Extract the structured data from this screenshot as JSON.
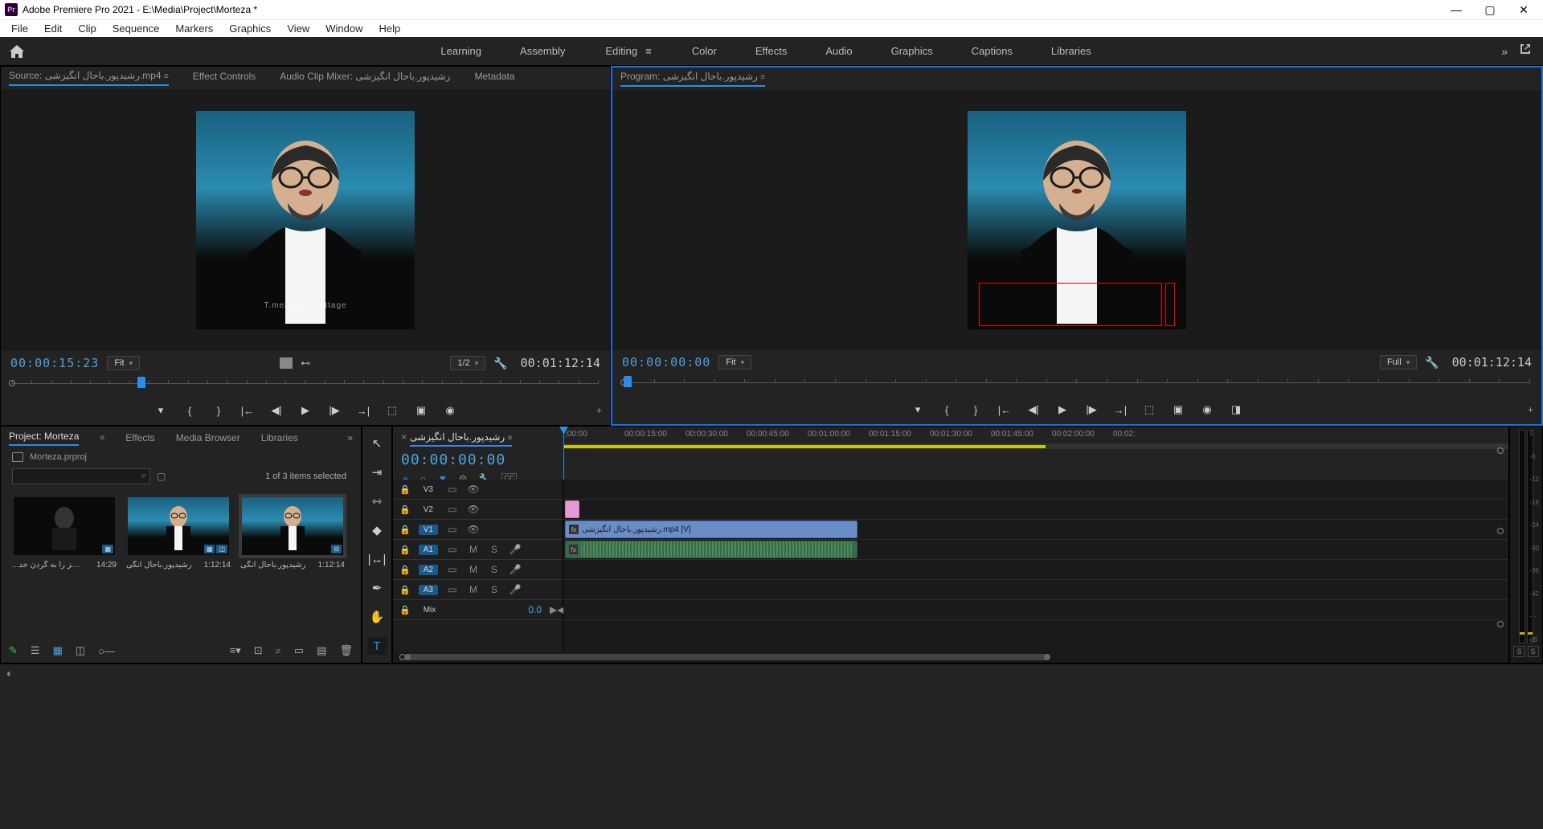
{
  "titlebar": {
    "app_icon_text": "Pr",
    "title": "Adobe Premiere Pro 2021 - E:\\Media\\Project\\Morteza *"
  },
  "menubar": [
    "File",
    "Edit",
    "Clip",
    "Sequence",
    "Markers",
    "Graphics",
    "View",
    "Window",
    "Help"
  ],
  "workspaces": {
    "items": [
      "Learning",
      "Assembly",
      "Editing",
      "Color",
      "Effects",
      "Audio",
      "Graphics",
      "Captions",
      "Libraries"
    ],
    "active": "Editing"
  },
  "source_panel": {
    "tabs": [
      "Source: رشیدپور.باحال انگیزشی.mp4",
      "Effect Controls",
      "Audio Clip Mixer: رشیدپور.باحال انگیزشی",
      "Metadata"
    ],
    "active_tab": 0,
    "watermark": "T.me/MovieCottage",
    "timecode": "00:00:15:23",
    "fit_label": "Fit",
    "ratio_label": "1/2",
    "duration": "00:01:12:14"
  },
  "program_panel": {
    "tab": "Program: رشیدپور.باحال انگیزشی",
    "timecode": "00:00:00:00",
    "fit_label": "Fit",
    "full_label": "Full",
    "duration": "00:01:12:14"
  },
  "project_panel": {
    "tabs": [
      "Project: Morteza",
      "Effects",
      "Media Browser",
      "Libraries"
    ],
    "active_tab": 0,
    "project_file": "Morteza.prproj",
    "search_placeholder": "",
    "selection_text": "1 of 3 items selected",
    "items": [
      {
        "name": "...همه چیز را به گردن خد",
        "duration": "14:29",
        "selected": false,
        "blue": false
      },
      {
        "name": "رشیدپور.باحال انگی",
        "duration": "1:12:14",
        "selected": false,
        "blue": true
      },
      {
        "name": "رشیدپور.باحال انگی",
        "duration": "1:12:14",
        "selected": true,
        "blue": true
      }
    ]
  },
  "timeline": {
    "sequence_name": "رشیدپور.باحال انگیزشی",
    "timecode": "00:00:00:00",
    "ruler_labels": [
      ";00:00",
      "00:00:15:00",
      "00:00:30:00",
      "00:00:45:00",
      "00:01:00:00",
      "00:01:15:00",
      "00:01:30:00",
      "00:01:45:00",
      "00:02:00:00",
      "00:02:"
    ],
    "video_tracks": [
      {
        "label": "V3",
        "active": false
      },
      {
        "label": "V2",
        "active": false
      },
      {
        "label": "V1",
        "active": true
      }
    ],
    "audio_tracks": [
      {
        "label": "A1",
        "active": true
      },
      {
        "label": "A2",
        "active": true
      },
      {
        "label": "A3",
        "active": true
      }
    ],
    "mix_label": "Mix",
    "mix_value": "0.0",
    "v1_clip_name": "رشیدپور.باحال انگیزشی.mp4 [V]"
  },
  "meters": {
    "scale": [
      "0",
      "-6",
      "-12",
      "-18",
      "-24",
      "-30",
      "-36",
      "-42",
      "- -",
      "dB"
    ],
    "footer": [
      "S",
      "S"
    ]
  }
}
